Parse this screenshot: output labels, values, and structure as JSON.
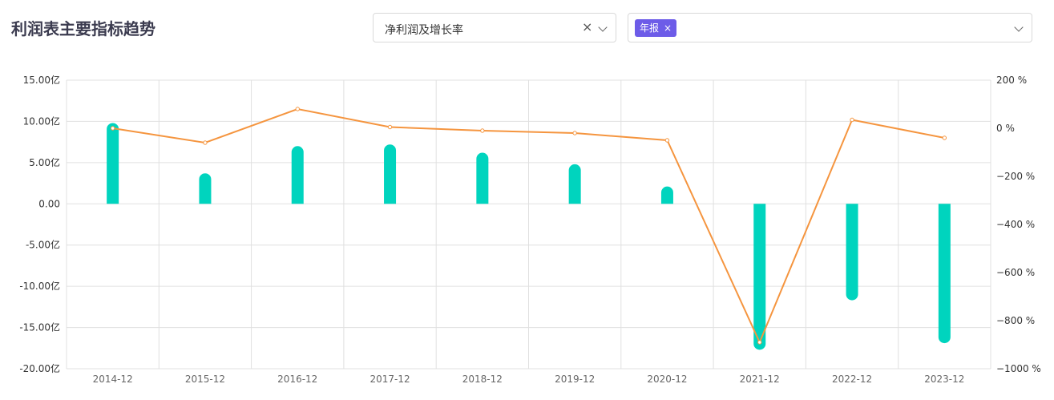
{
  "header": {
    "title": "利润表主要指标趋势"
  },
  "filters": {
    "metric_select_value": "净利润及增长率",
    "clear_symbol": "×",
    "period_tag": "年报",
    "tag_close_symbol": "×"
  },
  "colors": {
    "bar": "#00d4be",
    "line": "#f5953f",
    "tag_bg": "#6d5ce8",
    "grid": "#e0e0e0"
  },
  "chart_data": {
    "type": "bar",
    "categories": [
      "2014-12",
      "2015-12",
      "2016-12",
      "2017-12",
      "2018-12",
      "2019-12",
      "2020-12",
      "2021-12",
      "2022-12",
      "2023-12"
    ],
    "series": [
      {
        "type": "bar",
        "axis": "left",
        "values": [
          9.8,
          3.7,
          7.0,
          7.2,
          6.2,
          4.8,
          2.1,
          -17.7,
          -11.7,
          -16.9
        ]
      },
      {
        "type": "line",
        "axis": "right",
        "values": [
          0,
          -60,
          80,
          5,
          -10,
          -20,
          -50,
          -890,
          35,
          -40
        ]
      }
    ],
    "y_left": {
      "range": [
        -20,
        15
      ],
      "ticks": [
        15,
        10,
        5,
        0,
        -5,
        -10,
        -15,
        -20
      ],
      "tick_labels": [
        "15.00亿",
        "10.00亿",
        "5.00亿",
        "0.00",
        "-5.00亿",
        "-10.00亿",
        "-15.00亿",
        "-20.00亿"
      ]
    },
    "y_right": {
      "range": [
        -1000,
        200
      ],
      "ticks": [
        200,
        0,
        -200,
        -400,
        -600,
        -800,
        -1000
      ],
      "tick_labels": [
        "200 %",
        "0 %",
        "−200 %",
        "−400 %",
        "−600 %",
        "−800 %",
        "−1000 %"
      ]
    },
    "grid": true,
    "legend": "none"
  }
}
